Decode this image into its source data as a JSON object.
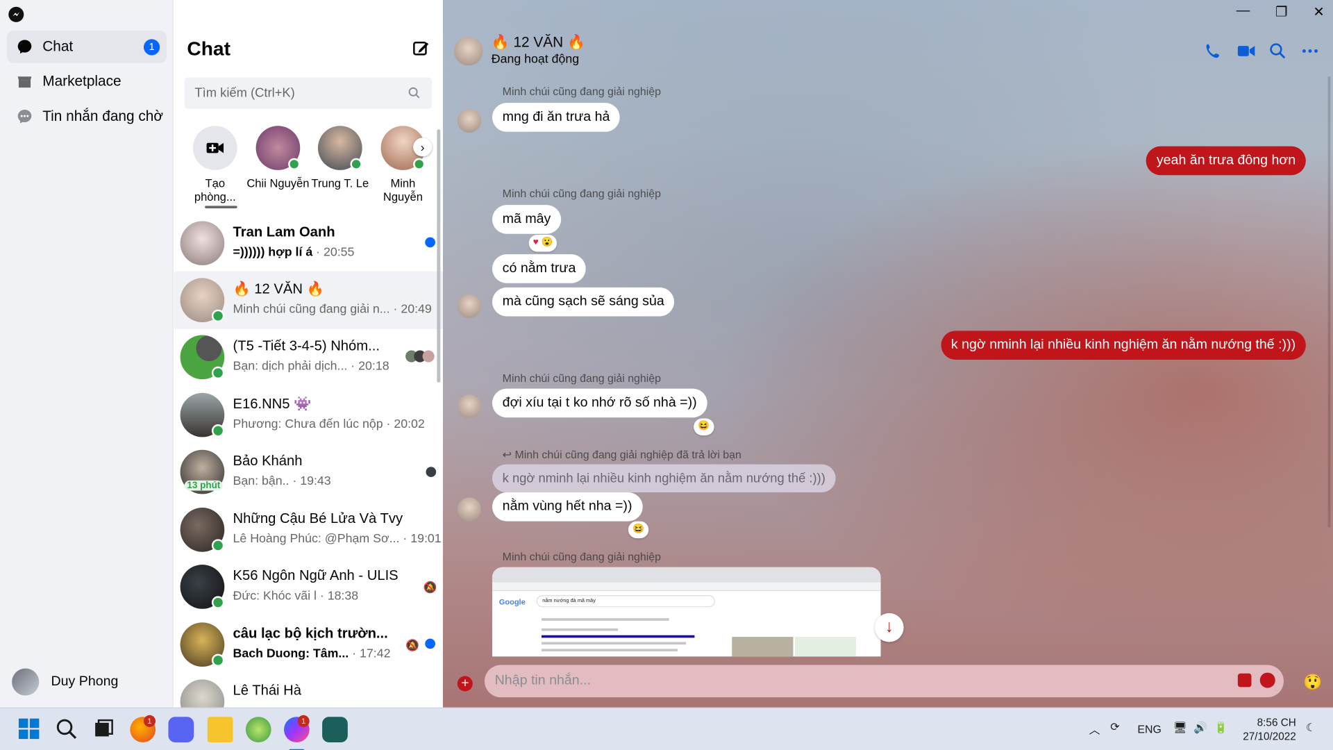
{
  "nav": {
    "items": [
      {
        "label": "Chat",
        "badge": "1"
      },
      {
        "label": "Marketplace"
      },
      {
        "label": "Tin nhắn đang chờ"
      }
    ],
    "user": "Duy Phong"
  },
  "list": {
    "title": "Chat",
    "search_placeholder": "Tìm kiếm (Ctrl+K)",
    "stories": [
      {
        "label": "Tạo phòng..."
      },
      {
        "label": "Chii Nguyễn"
      },
      {
        "label": "Trung T. Le"
      },
      {
        "label": "Minh Nguyễn"
      }
    ],
    "conversations": [
      {
        "name": "Tran Lam Oanh",
        "preview": "=)))))) hợp lí á",
        "time": "· 20:55"
      },
      {
        "name": "🔥 12 VĂN 🔥",
        "preview": "Minh chúi cũng đang giải n...",
        "time": "· 20:49"
      },
      {
        "name": "(T5 -Tiết 3-4-5) Nhóm...",
        "preview": "Bạn: dịch phải dịch...",
        "time": "· 20:18"
      },
      {
        "name": "E16.NN5 👾",
        "preview": "Phương: Chưa đến lúc nộp",
        "time": "· 20:02"
      },
      {
        "name": "Bảo Khánh",
        "preview": "Bạn: bận..",
        "time": "· 19:43",
        "tag": "13 phút"
      },
      {
        "name": "Những Cậu Bé Lửa Và Tvy",
        "preview": "Lê Hoàng Phúc: @Phạm Sơ...",
        "time": "· 19:01"
      },
      {
        "name": "K56 Ngôn Ngữ Anh - ULIS",
        "preview": "Đức: Khóc vãi l",
        "time": "· 18:38"
      },
      {
        "name": "câu lạc bộ kịch trườn...",
        "preview": "Bach Duong: Tâm...",
        "time": "· 17:42"
      },
      {
        "name": "Lê Thái Hà",
        "preview": "",
        "time": ""
      }
    ]
  },
  "conversation": {
    "title": "🔥 12 VĂN 🔥",
    "status": "Đang hoạt động",
    "sender": "Minh chúi cũng đang giải nghiệp",
    "messages": {
      "m1": "mng đi ăn trưa hả",
      "me1": "yeah ăn trưa đông hơn",
      "m2": "mã mây",
      "m3": "có nằm trưa",
      "m4": "mà cũng sạch sẽ sáng sủa",
      "me2": "k ngờ nminh lại nhiều kinh nghiệm ăn nằm nướng thế :)))",
      "m5": "đợi xíu tại t ko nhớ rõ số nhà =))",
      "reply_label": "Minh chúi cũng đang giải nghiệp đã trả lời bạn",
      "quoted": "k ngờ nminh lại nhiều kinh nghiệm ăn nằm nướng thế :)))",
      "m6": "nằm vùng hết nha =))"
    },
    "screenshot": {
      "logo": "Google",
      "query": "nằm nướng đà mã mây"
    },
    "input_placeholder": "Nhập tin nhắn..."
  },
  "taskbar": {
    "lang": "ENG",
    "time": "8:56 CH",
    "date": "27/10/2022",
    "badge_browser": "1",
    "badge_messenger": "1"
  },
  "colors": {
    "accent": "#c0151a",
    "blue": "#0866ff",
    "online": "#31a24c"
  }
}
